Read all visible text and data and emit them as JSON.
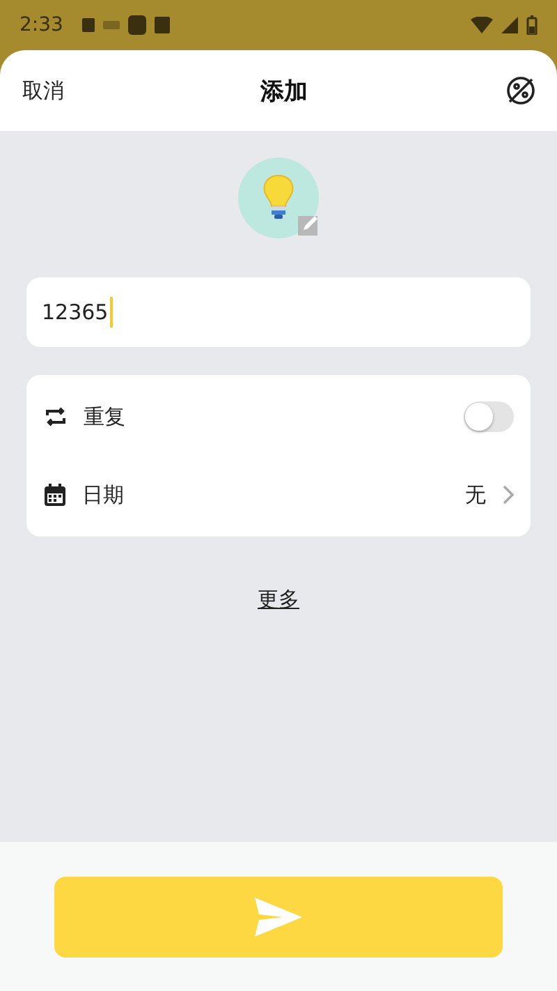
{
  "status_bar": {
    "time": "2:33"
  },
  "header": {
    "cancel": "取消",
    "title": "添加"
  },
  "name_field": {
    "value": "12365"
  },
  "options": [
    {
      "kind": "toggle",
      "label": "重复",
      "on": false
    },
    {
      "kind": "link",
      "label": "日期",
      "value": "无"
    }
  ],
  "more_link": "更多"
}
